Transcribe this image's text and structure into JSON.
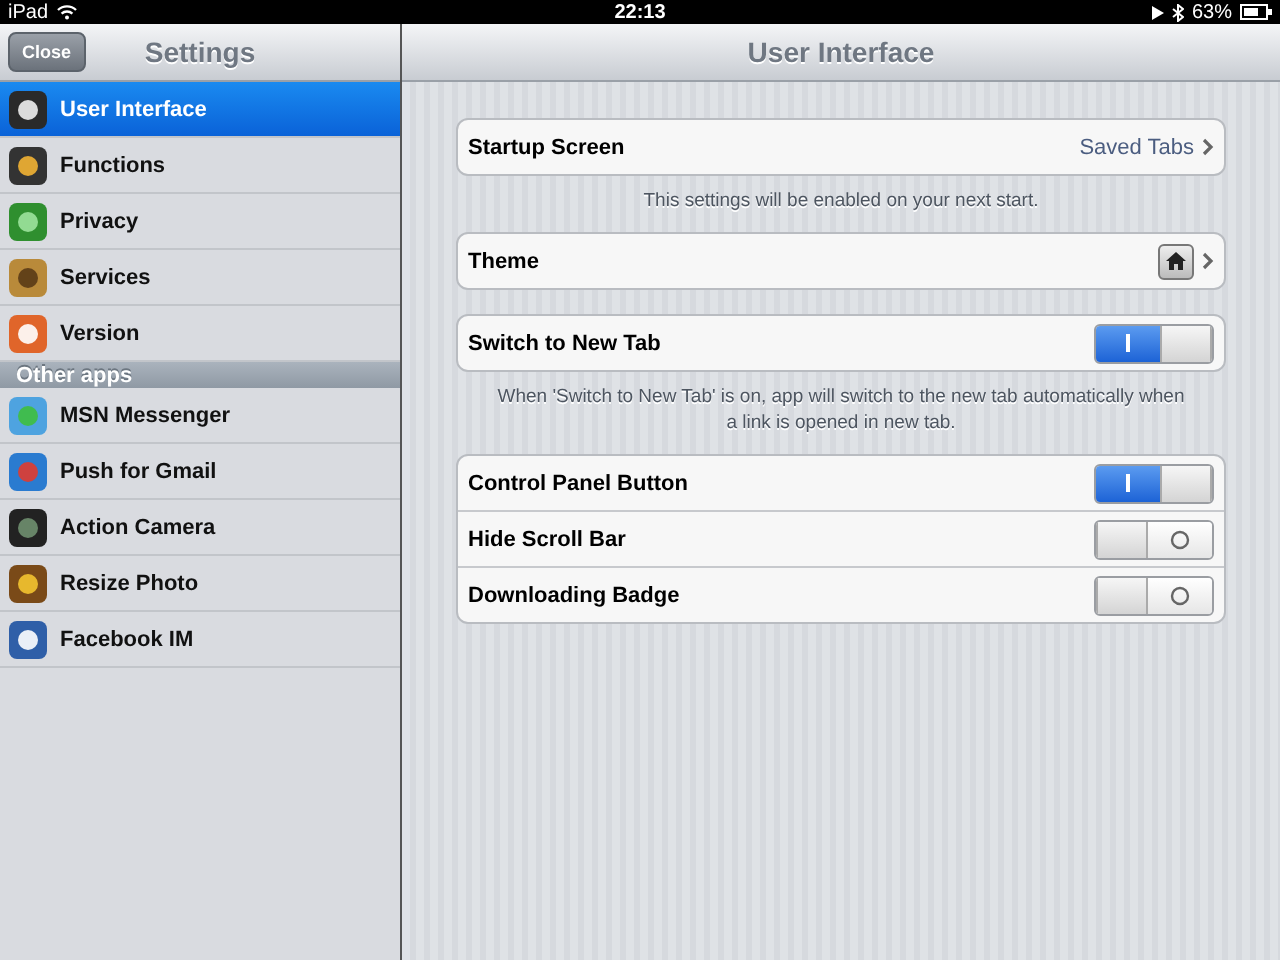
{
  "status_bar": {
    "device": "iPad",
    "time": "22:13",
    "battery": "63%"
  },
  "sidebar": {
    "close_button": "Close",
    "title": "Settings",
    "items": [
      {
        "label": "User Interface",
        "selected": true
      },
      {
        "label": "Functions",
        "selected": false
      },
      {
        "label": "Privacy",
        "selected": false
      },
      {
        "label": "Services",
        "selected": false
      },
      {
        "label": "Version",
        "selected": false
      }
    ],
    "section_header": "Other apps",
    "apps": [
      {
        "label": "MSN Messenger",
        "selected": false
      },
      {
        "label": "Push for Gmail",
        "selected": false
      },
      {
        "label": "Action Camera",
        "selected": false
      },
      {
        "label": "Resize Photo",
        "selected": false
      },
      {
        "label": "Facebook IM",
        "selected": false
      }
    ]
  },
  "detail": {
    "title": "User Interface",
    "groups": [
      {
        "rows": [
          {
            "kind": "disclosure",
            "label": "Startup Screen",
            "value": "Saved Tabs"
          }
        ],
        "footer": "This settings will be enabled on your next start."
      },
      {
        "rows": [
          {
            "kind": "theme",
            "label": "Theme"
          }
        ]
      },
      {
        "rows": [
          {
            "kind": "switch",
            "label": "Switch to New Tab",
            "on": true
          }
        ],
        "footer": "When 'Switch to New Tab' is on, app will switch to the new tab automatically when a link is opened in new tab."
      },
      {
        "rows": [
          {
            "kind": "switch",
            "label": "Control Panel Button",
            "on": true
          },
          {
            "kind": "switch",
            "label": "Hide Scroll Bar",
            "on": false
          },
          {
            "kind": "switch",
            "label": "Downloading Badge",
            "on": false
          }
        ]
      }
    ]
  }
}
